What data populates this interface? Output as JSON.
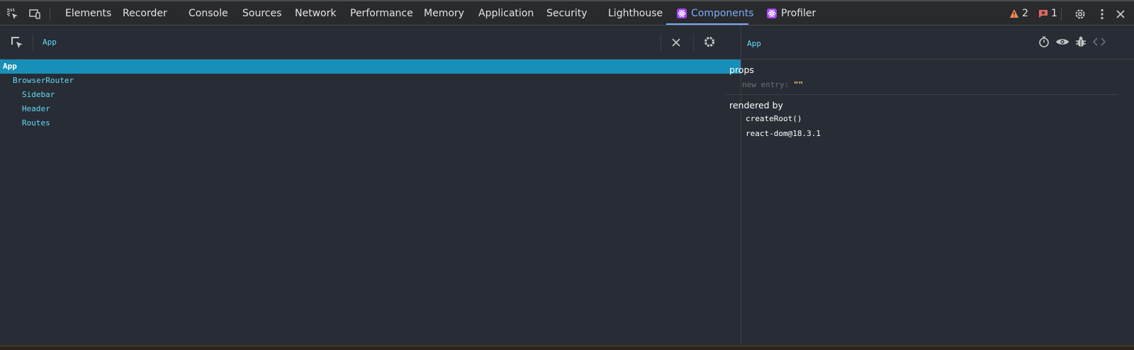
{
  "devtools": {
    "tabs": [
      {
        "label": "Elements"
      },
      {
        "label": "Recorder"
      },
      {
        "label": "Console"
      },
      {
        "label": "Sources"
      },
      {
        "label": "Network"
      },
      {
        "label": "Performance"
      },
      {
        "label": "Memory"
      },
      {
        "label": "Application"
      },
      {
        "label": "Security"
      },
      {
        "label": "Lighthouse"
      },
      {
        "label": "Components"
      },
      {
        "label": "Profiler"
      }
    ],
    "active_tab": "Components",
    "warnings_count": "2",
    "errors_count": "1",
    "colors": {
      "accent": "#7cacf8",
      "selection": "#178fb9",
      "react_badge": "#a142f4",
      "component_name": "#61dafb"
    }
  },
  "tree": {
    "owner_crumb": "App",
    "rows": [
      {
        "name": "App",
        "selected": true
      },
      {
        "name": "BrowserRouter"
      },
      {
        "name": "Sidebar"
      },
      {
        "name": "Header"
      },
      {
        "name": "Routes"
      }
    ]
  },
  "inspector": {
    "component_name": "App",
    "props_title": "props",
    "new_entry_placeholder": "new entry",
    "new_entry_value": "\"\"",
    "rendered_by_title": "rendered by",
    "rendered_by": [
      "createRoot()",
      "react-dom@18.3.1"
    ]
  },
  "icons": [
    "inspect-element-icon",
    "device-toolbar-icon",
    "warning-icon",
    "error-icon",
    "settings-icon",
    "more-vert-icon",
    "close-icon",
    "select-element-icon",
    "clear-search-icon",
    "gear-icon",
    "stopwatch-icon",
    "eye-icon",
    "bug-icon",
    "source-code-icon",
    "react-icon"
  ]
}
